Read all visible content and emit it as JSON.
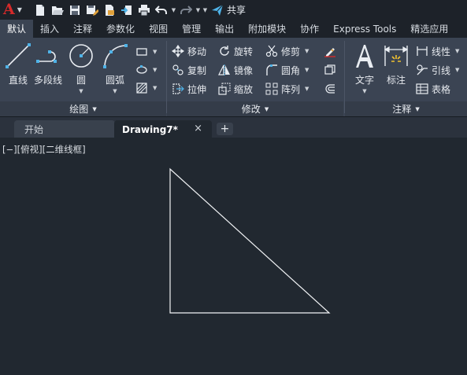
{
  "app": {
    "logo_letter": "A",
    "brand_color": "#d42a2a",
    "share_label": "共享"
  },
  "quick_access": [
    "new-file-icon",
    "open-folder-icon",
    "save-icon",
    "save-as-icon",
    "publish-icon",
    "import-icon",
    "print-icon",
    "undo-icon",
    "redo-icon"
  ],
  "ribbon_tabs": [
    {
      "label": "默认",
      "active": true
    },
    {
      "label": "插入"
    },
    {
      "label": "注释"
    },
    {
      "label": "参数化"
    },
    {
      "label": "视图"
    },
    {
      "label": "管理"
    },
    {
      "label": "输出"
    },
    {
      "label": "附加模块"
    },
    {
      "label": "协作"
    },
    {
      "label": "Express Tools"
    },
    {
      "label": "精选应用"
    }
  ],
  "panels": {
    "draw": {
      "title": "绘图",
      "tools": {
        "line": "直线",
        "polyline": "多段线",
        "circle": "圆",
        "arc": "圆弧"
      }
    },
    "modify": {
      "title": "修改",
      "tools": {
        "move": "移动",
        "rotate": "旋转",
        "trim": "修剪",
        "copy": "复制",
        "mirror": "镜像",
        "fillet": "圆角",
        "stretch": "拉伸",
        "scale": "缩放",
        "array": "阵列"
      }
    },
    "annotation": {
      "title": "注释",
      "tools": {
        "text": "文字",
        "dimension": "标注",
        "linear": "线性",
        "leader": "引线",
        "table": "表格"
      }
    }
  },
  "document_tabs": {
    "start": "开始",
    "current": "Drawing7*",
    "new_tab": "+",
    "close": "×"
  },
  "viewport": {
    "label": "[−][俯视][二维线框]"
  }
}
